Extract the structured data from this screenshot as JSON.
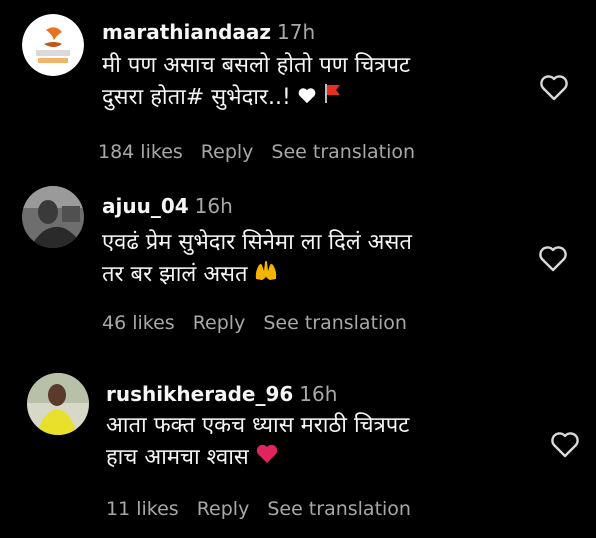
{
  "comments": [
    {
      "username": "marathiandaaz",
      "time": "17h",
      "line1": "मी पण असाच बसलो होतो पण चित्रपट",
      "line2": "दुसरा होता# सुभेदार..!",
      "emojis": [
        "white-heart",
        "red-flag"
      ],
      "likes": "184 likes",
      "reply": "Reply",
      "translate": "See translation"
    },
    {
      "username": "ajuu_04",
      "time": "16h",
      "line1": "एवढं प्रेम सुभेदार सिनेमा ला दिलं असत",
      "line2": "तर बर झालं असत",
      "emojis": [
        "raising-hands"
      ],
      "likes": "46 likes",
      "reply": "Reply",
      "translate": "See translation"
    },
    {
      "username": "rushikherade_96",
      "time": "16h",
      "line1": "आता फक्त एकच ध्यास मराठी चित्रपट",
      "line2": "हाच आमचा श्वास",
      "emojis": [
        "red-heart"
      ],
      "likes": "11 likes",
      "reply": "Reply",
      "translate": "See translation"
    }
  ],
  "icons": {
    "like": "heart-outline-icon"
  },
  "colors": {
    "background": "#000000",
    "primary_text": "#f5f5f5",
    "secondary_text": "#a8a8a8",
    "red": "#e0245e"
  }
}
